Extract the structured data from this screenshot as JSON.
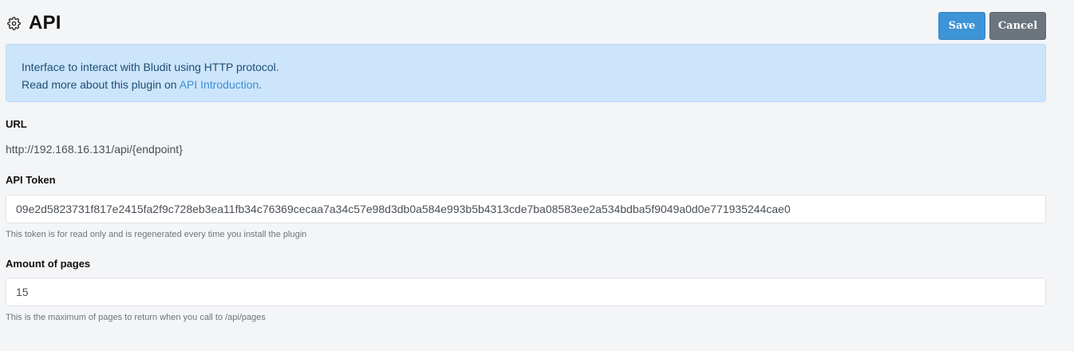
{
  "header": {
    "title": "API",
    "icon": "gear-icon",
    "save_label": "Save",
    "cancel_label": "Cancel"
  },
  "alert": {
    "line1": "Interface to interact with Bludit using HTTP protocol.",
    "line2_prefix": "Read more about this plugin on ",
    "line2_link": "API Introduction",
    "line2_suffix": "."
  },
  "url": {
    "label": "URL",
    "value": "http://192.168.16.131/api/{endpoint}"
  },
  "token": {
    "label": "API Token",
    "value": "09e2d5823731f817e2415fa2f9c728eb3ea11fb34c76369cecaa7a34c57e98d3db0a584e993b5b4313cde7ba08583ee2a534bdba5f9049a0d0e771935244cae0",
    "help": "This token is for read only and is regenerated every time you install the plugin"
  },
  "pages": {
    "label": "Amount of pages",
    "value": "15",
    "help": "This is the maximum of pages to return when you call to /api/pages"
  },
  "colors": {
    "primary": "#3d94d6",
    "secondary": "#6c757d",
    "alert_bg": "#cce5fb",
    "link": "#3d8fd4"
  }
}
